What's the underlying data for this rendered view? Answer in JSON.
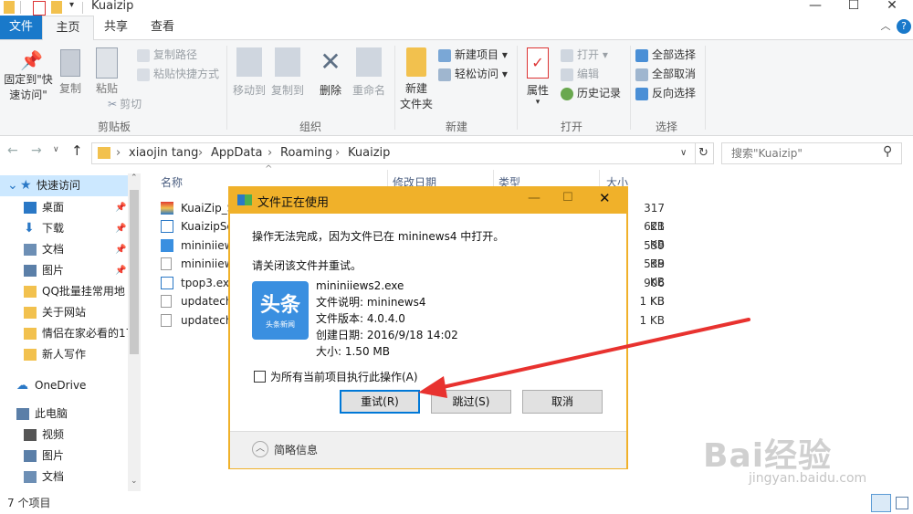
{
  "window": {
    "title": "Kuaizip"
  },
  "tabs": {
    "file": "文件",
    "home": "主页",
    "share": "共享",
    "view": "查看"
  },
  "ribbon": {
    "clipboard": {
      "pin_label_1": "固定到\"快",
      "pin_label_2": "速访问\"",
      "copy": "复制",
      "paste": "粘贴",
      "copy_path": "复制路径",
      "paste_shortcut": "粘贴快捷方式",
      "cut": "剪切",
      "group": "剪贴板"
    },
    "organize": {
      "move_to": "移动到",
      "copy_to": "复制到",
      "delete": "删除",
      "rename": "重命名",
      "group": "组织"
    },
    "new": {
      "new_folder_1": "新建",
      "new_folder_2": "文件夹",
      "new_item": "新建项目",
      "easy_access": "轻松访问",
      "group": "新建"
    },
    "open": {
      "properties": "属性",
      "open": "打开",
      "edit": "编辑",
      "history": "历史记录",
      "group": "打开"
    },
    "select": {
      "select_all": "全部选择",
      "select_none": "全部取消",
      "invert": "反向选择",
      "group": "选择"
    }
  },
  "address": {
    "crumbs": [
      "xiaojin tang",
      "AppData",
      "Roaming",
      "Kuaizip"
    ],
    "search_placeholder": "搜索\"Kuaizip\""
  },
  "nav": {
    "items": [
      {
        "label": "快速访问",
        "icon": "star-icon"
      },
      {
        "label": "桌面",
        "icon": "desktop-icon"
      },
      {
        "label": "下载",
        "icon": "download-icon"
      },
      {
        "label": "文档",
        "icon": "document-icon"
      },
      {
        "label": "图片",
        "icon": "pictures-icon"
      },
      {
        "label": "QQ批量挂常用地",
        "icon": "folder-icon"
      },
      {
        "label": "关于网站",
        "icon": "folder-icon"
      },
      {
        "label": "情侣在家必看的17",
        "icon": "folder-icon"
      },
      {
        "label": "新人写作",
        "icon": "folder-icon"
      },
      {
        "label": "OneDrive",
        "icon": "cloud-icon"
      },
      {
        "label": "此电脑",
        "icon": "computer-icon"
      },
      {
        "label": "视频",
        "icon": "video-icon"
      },
      {
        "label": "图片",
        "icon": "pictures-icon"
      },
      {
        "label": "文档",
        "icon": "document-icon"
      }
    ]
  },
  "files": {
    "headers": {
      "name": "名称",
      "date": "修改日期",
      "type": "类型",
      "size": "大小"
    },
    "rows": [
      {
        "name": "KuaiZip_S",
        "size": "317 KB"
      },
      {
        "name": "KuaizipSe",
        "size": "621 KB"
      },
      {
        "name": "mininiiews",
        "size": "539 KB"
      },
      {
        "name": "mininiiews",
        "size": "539 KB"
      },
      {
        "name": "tpop3.exe",
        "size": "906 KB"
      },
      {
        "name": "updateche",
        "size": "1 KB"
      },
      {
        "name": "updateche",
        "size": "1 KB"
      }
    ]
  },
  "status": {
    "count": "7 个项目"
  },
  "dialog": {
    "title": "文件正在使用",
    "message": "操作无法完成，因为文件已在 mininews4 中打开。",
    "hint": "请关闭该文件并重试。",
    "file_name": "mininiiews2.exe",
    "desc": "文件说明: mininews4",
    "version": "文件版本: 4.0.4.0",
    "created": "创建日期: 2016/9/18 14:02",
    "size": "大小: 1.50 MB",
    "app_logo_text": "头条",
    "app_logo_sub": "头条新闻",
    "checkbox_label": "为所有当前项目执行此操作(A)",
    "retry": "重试(R)",
    "skip": "跳过(S)",
    "cancel": "取消",
    "details": "简略信息"
  },
  "watermark": {
    "brand": "Bai经验",
    "url": "jingyan.baidu.com"
  }
}
